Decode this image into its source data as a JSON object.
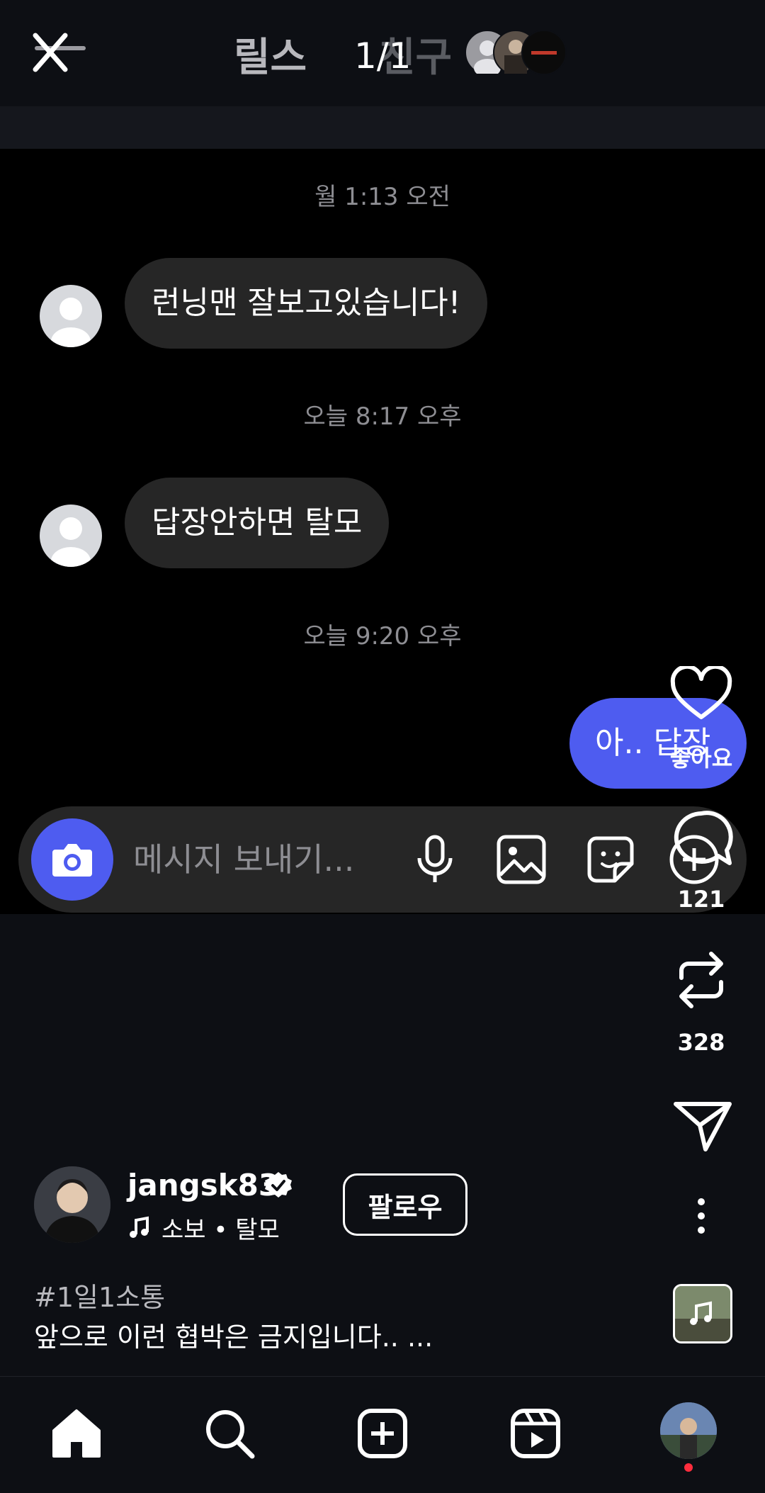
{
  "top_bar": {
    "tab_reels": "릴스",
    "tab_friends": "친구",
    "counter": "1/1"
  },
  "dm": {
    "messages": [
      {
        "timestamp": "월 1:13 오전",
        "text": "런닝맨 잘보고있습니다!",
        "direction": "incoming"
      },
      {
        "timestamp": "오늘 8:17 오후",
        "text": "답장안하면 탈모",
        "direction": "incoming"
      },
      {
        "timestamp": "오늘 9:20 오후",
        "text": "아.. 답장",
        "direction": "outgoing"
      }
    ],
    "composer": {
      "placeholder": "메시지 보내기..."
    }
  },
  "actions": {
    "like_label": "좋아요",
    "comments": "121",
    "reposts": "328"
  },
  "post": {
    "username": "jangsk83",
    "audio": "소보 • 탈모",
    "follow_label": "팔로우",
    "hashtag": "#1일1소통",
    "caption": "앞으로 이런 협박은 금지입니다.. ..."
  },
  "colors": {
    "accent_blue": "#4e5cf0",
    "bubble_gray": "#262626",
    "background": "#0d0f14",
    "notification_dot": "#ff2d3d"
  },
  "icons": [
    "close-icon",
    "camera-icon",
    "microphone-icon",
    "gallery-icon",
    "sticker-icon",
    "plus-circle-icon",
    "heart-icon",
    "comment-icon",
    "repost-icon",
    "send-icon",
    "more-icon",
    "music-note-icon",
    "verified-icon",
    "home-icon",
    "search-icon",
    "create-icon",
    "reels-icon"
  ]
}
